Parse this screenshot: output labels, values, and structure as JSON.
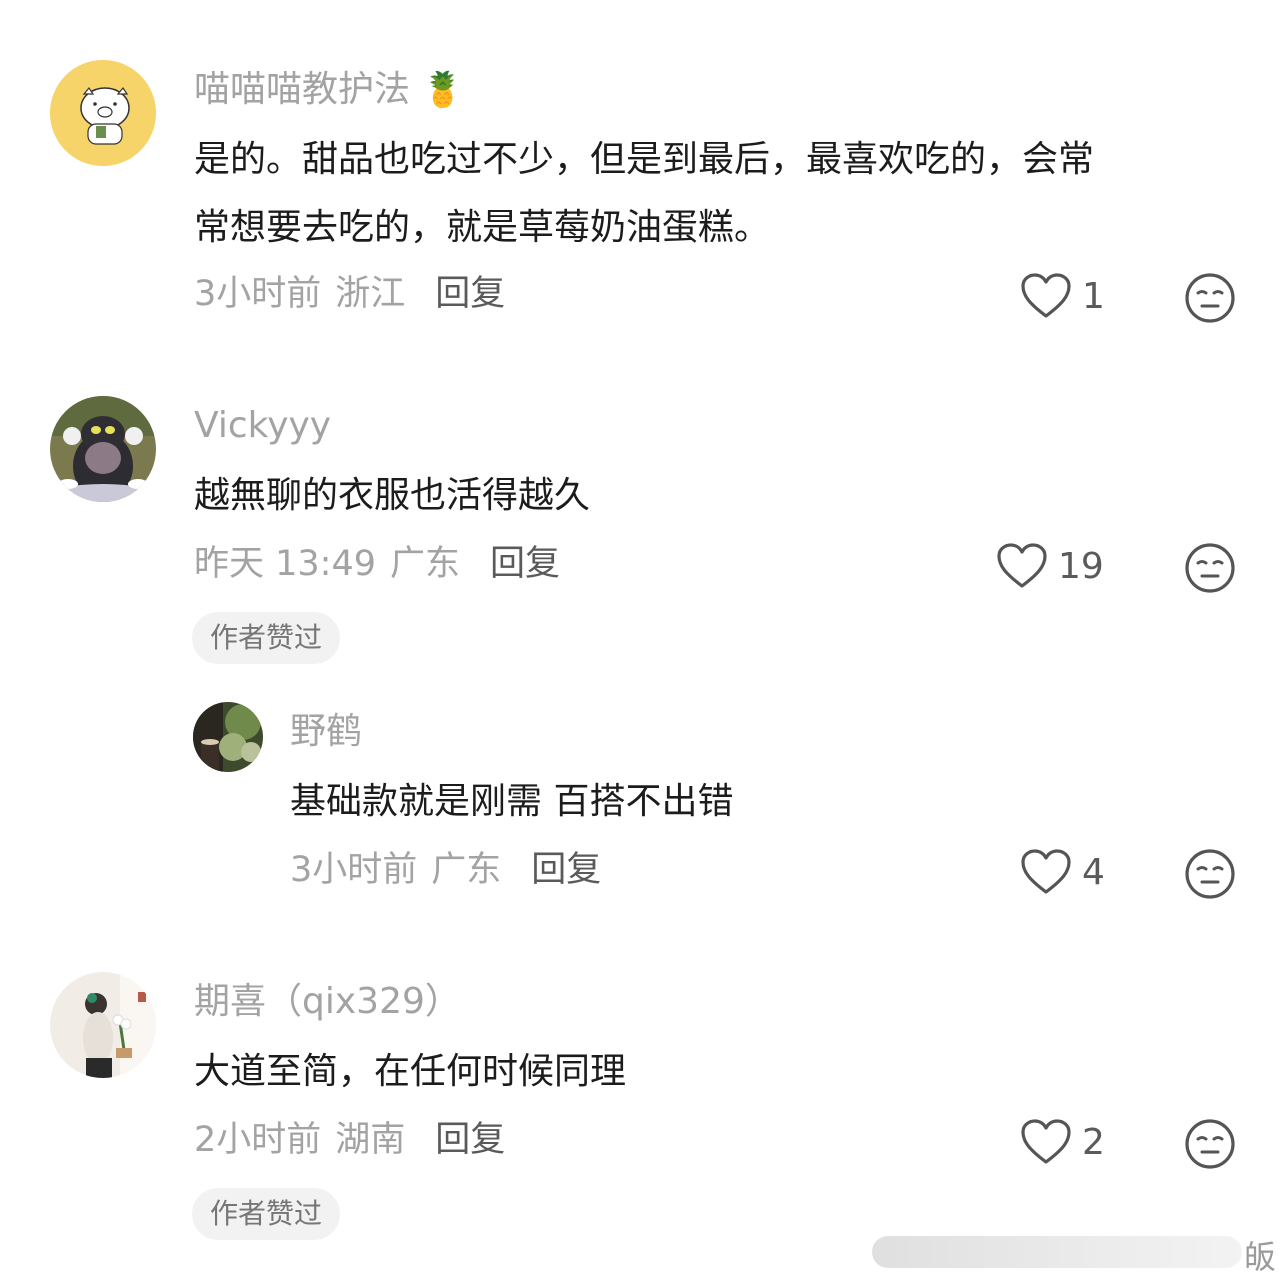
{
  "comments": [
    {
      "username": "喵喵喵教护法",
      "username_emoji": "🍍",
      "text_line1": "是的。甜品也吃过不少，但是到最后，最喜欢吃的，会常",
      "text_line2": "常想要去吃的，就是草莓奶油蛋糕。",
      "time": "3小时前",
      "location": "浙江",
      "reply_label": "回复",
      "likes": "1",
      "avatar_icon": "cartoon-pig-avatar"
    },
    {
      "username": "Vickyyy",
      "text_line1": "越無聊的衣服也活得越久",
      "time": "昨天 13:49",
      "location": "广东",
      "reply_label": "回复",
      "likes": "19",
      "badge": "作者赞过",
      "avatar_icon": "cartoon-cat-avatar",
      "replies": [
        {
          "username": "野鹤",
          "text_line1": "基础款就是刚需 百搭不出错",
          "time": "3小时前",
          "location": "广东",
          "reply_label": "回复",
          "likes": "4",
          "avatar_icon": "photo-forest-avatar"
        }
      ]
    },
    {
      "username": "期喜（qix329）",
      "text_line1": "大道至简，在任何时候同理",
      "time": "2小时前",
      "location": "湖南",
      "reply_label": "回复",
      "likes": "2",
      "badge": "作者赞过",
      "avatar_icon": "photo-woman-flowers-avatar"
    }
  ],
  "watermark": {
    "text": "皈"
  },
  "colors": {
    "username": "#a3a3a3",
    "body_text": "#1c1c1c",
    "meta": "#a3a3a3",
    "icon": "#555555",
    "badge_bg": "#f2f2f2"
  }
}
